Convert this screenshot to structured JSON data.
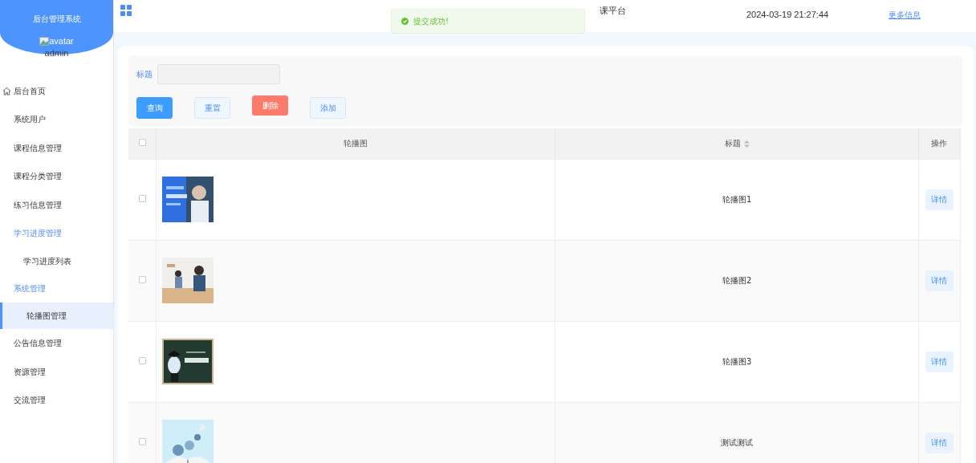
{
  "sidebar": {
    "title": "后台管理系统",
    "avatar_alt": "avatar",
    "user": "admin",
    "items": [
      {
        "label": "后台首页",
        "kind": "home",
        "selected": false
      },
      {
        "label": "系统用户",
        "kind": "link",
        "selected": false
      },
      {
        "label": "课程信息管理",
        "kind": "link",
        "selected": false
      },
      {
        "label": "课程分类管理",
        "kind": "link",
        "selected": false
      },
      {
        "label": "练习信息管理",
        "kind": "link",
        "selected": false
      },
      {
        "label": "学习进度管理",
        "kind": "group",
        "expanded": true,
        "selected": false,
        "children": [
          {
            "label": "学习进度列表",
            "selected": false
          }
        ]
      },
      {
        "label": "系统管理",
        "kind": "group",
        "expanded": true,
        "selected": false,
        "children": [
          {
            "label": "轮播图管理",
            "selected": true
          }
        ]
      },
      {
        "label": "公告信息管理",
        "kind": "link",
        "selected": false
      },
      {
        "label": "资源管理",
        "kind": "link",
        "selected": false
      },
      {
        "label": "交流管理",
        "kind": "link",
        "selected": false
      }
    ]
  },
  "header": {
    "title": "课平台",
    "datetime": "2024-03-19 21:27:44",
    "more": "更多信息"
  },
  "toast": {
    "message": "提交成功!",
    "kind": "success"
  },
  "filter": {
    "label": "标题",
    "buttons": [
      {
        "label": "查询",
        "kind": "primary"
      },
      {
        "label": "重置",
        "kind": "plain"
      },
      {
        "label": "删除",
        "kind": "danger"
      },
      {
        "label": "添加",
        "kind": "plain"
      }
    ]
  },
  "table": {
    "all_checked": false,
    "columns": [
      "轮播图",
      "标题",
      "操作"
    ],
    "rows": [
      {
        "title": "轮播图1",
        "action": "详情",
        "checked": false
      },
      {
        "title": "轮播图2",
        "action": "详情",
        "checked": false
      },
      {
        "title": "轮播图3",
        "action": "详情",
        "checked": false
      },
      {
        "title": "测试测试",
        "action": "详情",
        "checked": false
      }
    ]
  }
}
